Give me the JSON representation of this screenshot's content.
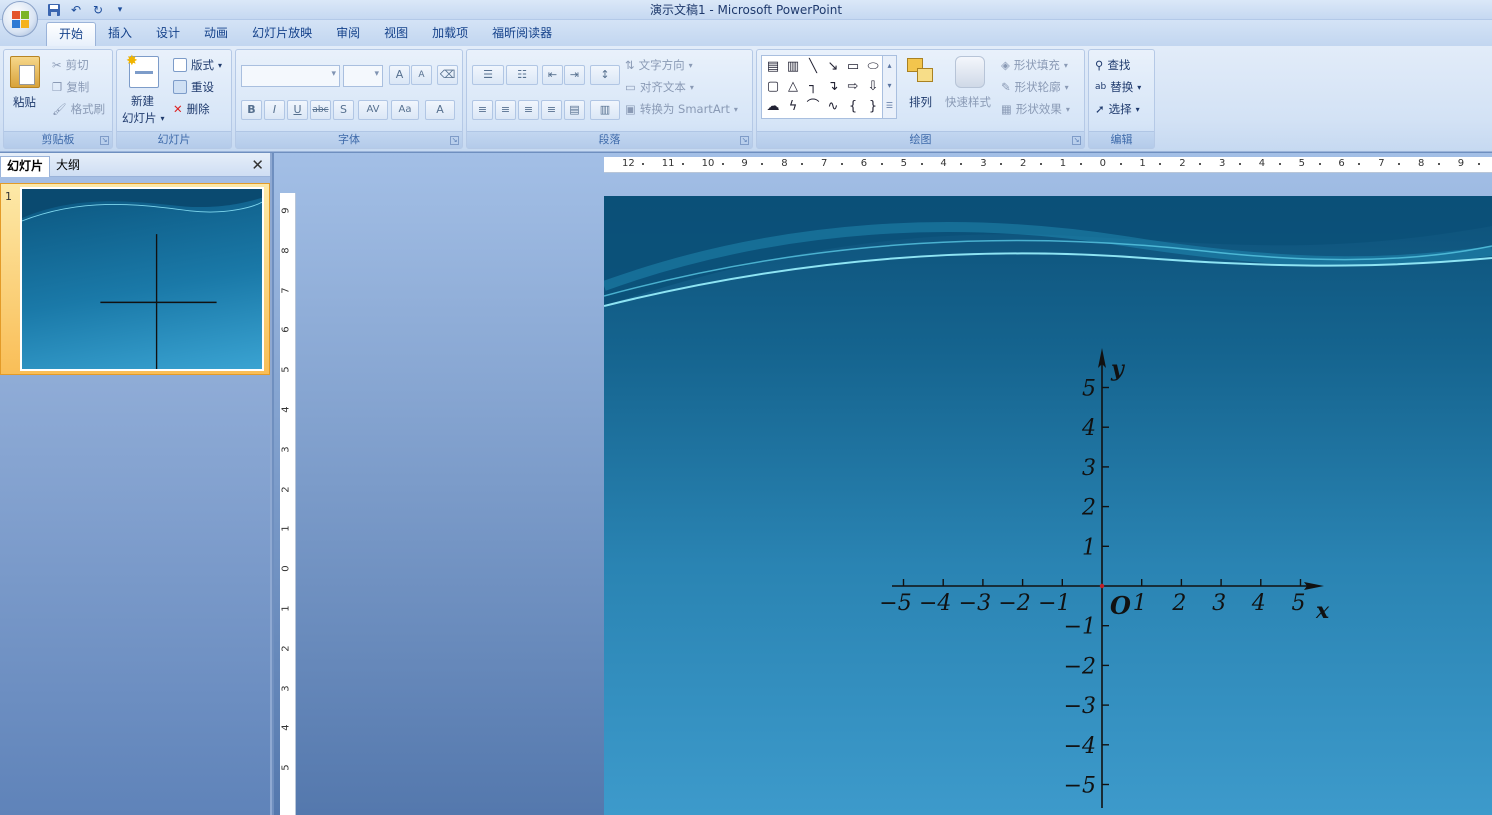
{
  "window": {
    "title": "演示文稿1 - Microsoft PowerPoint"
  },
  "tabs": [
    "开始",
    "插入",
    "设计",
    "动画",
    "幻灯片放映",
    "审阅",
    "视图",
    "加载项",
    "福昕阅读器"
  ],
  "ribbon": {
    "clipboard": {
      "label": "剪贴板",
      "paste": "粘贴",
      "cut": "剪切",
      "copy": "复制",
      "format_painter": "格式刷"
    },
    "slides": {
      "label": "幻灯片",
      "new_slide_line1": "新建",
      "new_slide_line2": "幻灯片",
      "layout": "版式",
      "reset": "重设",
      "delete": "删除"
    },
    "font": {
      "label": "字体",
      "font_name": "",
      "font_size": "",
      "grow": "A",
      "shrink": "A",
      "bold": "B",
      "italic": "I",
      "underline": "U",
      "strike": "abc",
      "shadow": "S",
      "spacing": "AV",
      "case": "Aa",
      "color": "A"
    },
    "paragraph": {
      "label": "段落",
      "text_direction": "文字方向",
      "align_text": "对齐文本",
      "smartart": "转换为 SmartArt"
    },
    "drawing": {
      "label": "绘图",
      "arrange": "排列",
      "quick_styles": "快速样式",
      "fill": "形状填充",
      "outline": "形状轮廓",
      "effects": "形状效果"
    },
    "editing": {
      "label": "编辑",
      "find": "查找",
      "replace": "替换",
      "select": "选择"
    }
  },
  "panel": {
    "tab_slides": "幻灯片",
    "tab_outline": "大纲",
    "slide_number": "1"
  },
  "ruler": {
    "h_labels": [
      "12",
      "11",
      "10",
      "9",
      "8",
      "7",
      "6",
      "5",
      "4",
      "3",
      "2",
      "1",
      "0",
      "1",
      "2",
      "3",
      "4",
      "5",
      "6",
      "7",
      "8",
      "9"
    ],
    "v_labels": [
      "9",
      "8",
      "7",
      "6",
      "5",
      "4",
      "3",
      "2",
      "1",
      "0",
      "1",
      "2",
      "3",
      "4",
      "5"
    ]
  },
  "slide": {
    "x_axis_label": "x",
    "y_axis_label": "y",
    "origin_label": "O",
    "x_ticks": [
      "−5",
      "−4",
      "−3",
      "−2",
      "−1",
      "1",
      "2",
      "3",
      "4",
      "5"
    ],
    "y_ticks": [
      "5",
      "4",
      "3",
      "2",
      "1",
      "−1",
      "−2",
      "−3",
      "−4",
      "−5"
    ]
  },
  "colors": {
    "accent_orange": "#f9be57",
    "slide_dark": "#0d5179",
    "slide_light": "#3d9acb"
  }
}
